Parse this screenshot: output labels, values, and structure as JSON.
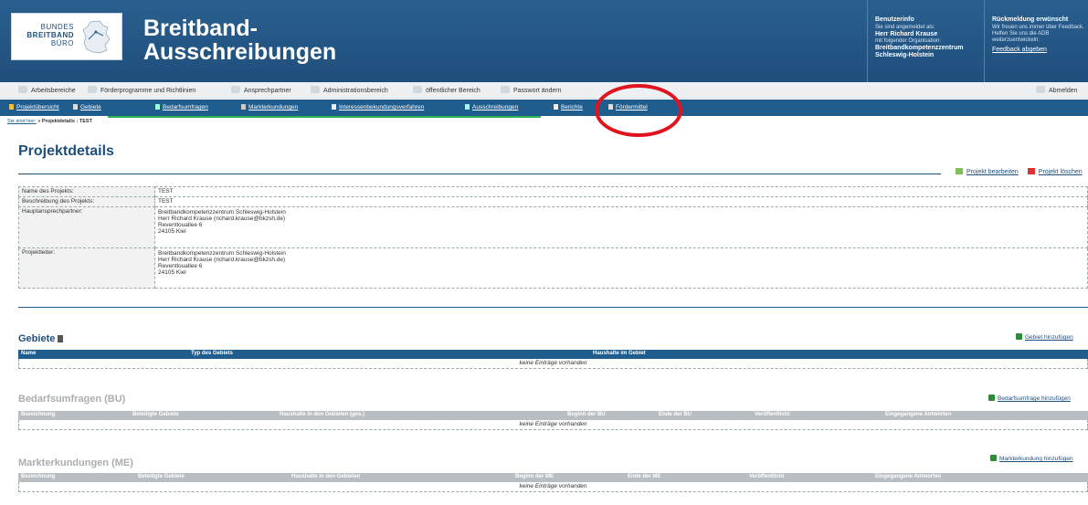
{
  "header": {
    "logo_lines": [
      "BUNDES",
      "BREITBAND",
      "BÜRO"
    ],
    "title_line1": "Breitband-",
    "title_line2": "Ausschreibungen",
    "user": {
      "heading": "Benutzerinfo",
      "signed_in_as": "Sie sind angemeldet als:",
      "name": "Herr Richard Krause",
      "org_label": "mit folgender Organisation:",
      "org_line1": "Breitbandkompetenzzentrum",
      "org_line2": "Schleswig-Holstein"
    },
    "feedback": {
      "heading": "Rückmeldung erwünscht",
      "text_line1": "Wir freuen uns immer über Feedback.",
      "text_line2": "Helfen Sie uns die ADB",
      "text_line3": "weiterzuentwickeln:",
      "link": "Feedback abgeben"
    }
  },
  "main_menu": {
    "items": [
      "Arbeitsbereiche",
      "Förderprogramme und Richtlinien",
      "Ansprechpartner",
      "Administrationsbereich",
      "öffentlicher Bereich",
      "Passwort ändern"
    ],
    "logout": "Abmelden"
  },
  "sub_menu": {
    "items": [
      "Projektübersicht",
      "Gebiete",
      "Bedarfsumfragen",
      "Markterkundungen",
      "Interessenbekundungsverfahren",
      "Ausschreibungen",
      "Berichte",
      "Fördermittel"
    ]
  },
  "breadcrumb": {
    "prefix": "Sie sind hier:",
    "path": "» Projektdetails : TEST"
  },
  "page": {
    "title": "Projektdetails",
    "edit": "Projekt bearbeiten",
    "delete": "Projekt löschen"
  },
  "details": {
    "rows": [
      {
        "key": "Name des Projekts:",
        "lines": [
          "TEST"
        ]
      },
      {
        "key": "Beschreibung des Projekts:",
        "lines": [
          "TEST"
        ]
      },
      {
        "key": "Hauptansprechpartner:",
        "lines": [
          "Breitbandkompetenzzentrum Schleswig-Holstein",
          "Herr Richard Krause (richard.krause@bkzsh.de)",
          "Reventlouallee 6",
          "24105 Kiel"
        ]
      },
      {
        "key": "Projektleiter:",
        "lines": [
          "Breitbandkompetenzzentrum Schleswig-Holstein",
          "Herr Richard Krause (richard.krause@bkzsh.de)",
          "Reventlouallee 6",
          "24105 Kiel"
        ]
      }
    ]
  },
  "sections": {
    "gebiete": {
      "title": "Gebiete",
      "add": "Gebiet hinzufügen",
      "columns": [
        "Name",
        "Typ des Gebiets",
        "Haushalte im Gebiet"
      ],
      "empty": "keine Einträge vorhanden"
    },
    "bu": {
      "title": "Bedarfsumfragen (BU)",
      "add": "Bedarfsumfrage hinzufügen",
      "columns": [
        "Bezeichnung",
        "Beteiligte Gebiete",
        "Haushalte in den Gebieten (ges.)",
        "Beginn der BU",
        "Ende der BU",
        "Veröffentlicht",
        "Eingegangene Antworten"
      ],
      "empty": "keine Einträge vorhanden"
    },
    "me": {
      "title": "Markterkundungen (ME)",
      "add": "Markterkundung hinzufügen",
      "columns": [
        "Bezeichnung",
        "Beteiligte Gebiete",
        "Haushalte in den Gebieten",
        "Beginn der ME",
        "Ende der ME",
        "Veröffentlicht",
        "Eingegangene Antworten"
      ],
      "empty": "keine Einträge vorhanden"
    }
  },
  "colors": {
    "header_blue": "#1f4f7c",
    "submenu_blue": "#1f5d8f",
    "highlight_green": "#2db34a",
    "highlight_red": "#e0141e",
    "inactive_header": "#b9bec2"
  }
}
